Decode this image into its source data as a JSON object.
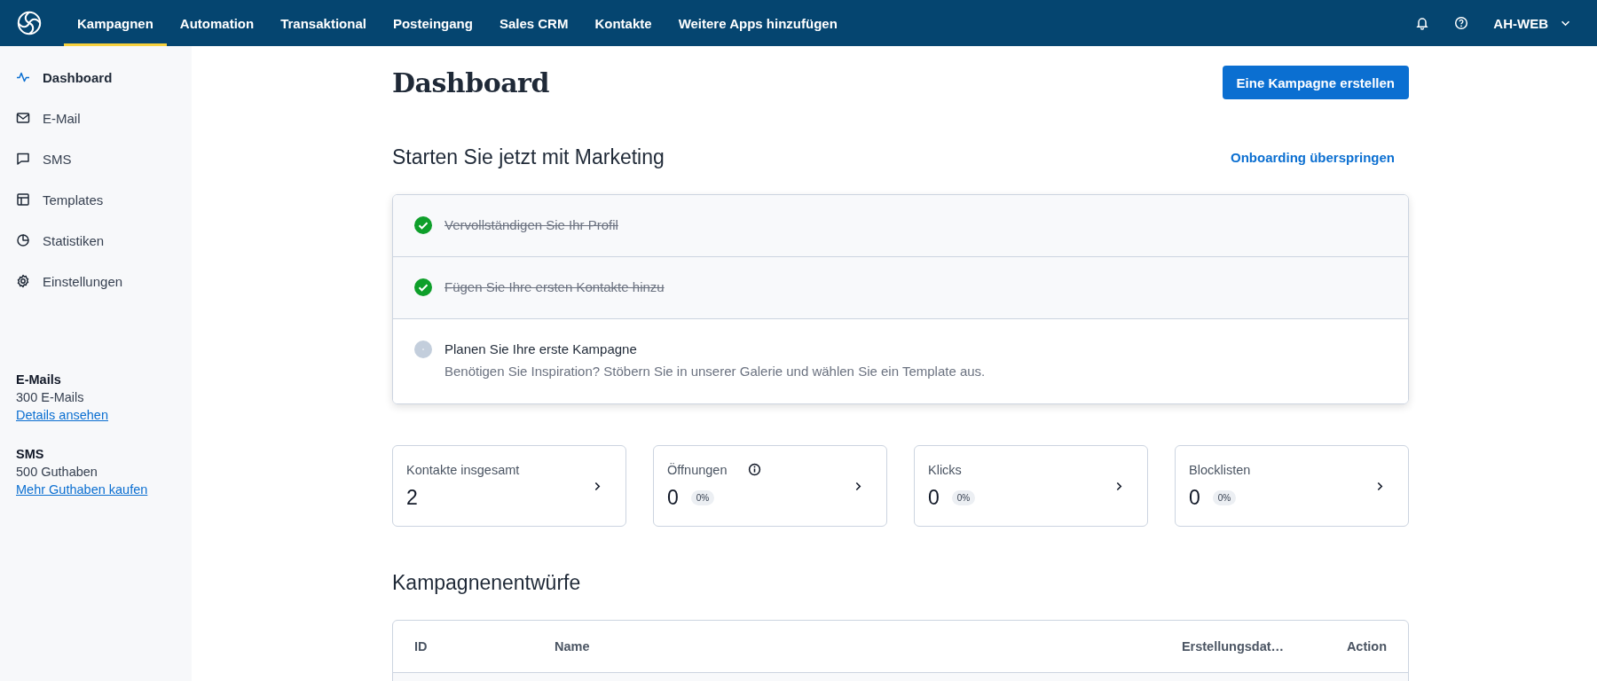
{
  "topbar": {
    "nav": [
      {
        "label": "Kampagnen",
        "selected": true
      },
      {
        "label": "Automation",
        "selected": false
      },
      {
        "label": "Transaktional",
        "selected": false
      },
      {
        "label": "Posteingang",
        "selected": false
      },
      {
        "label": "Sales CRM",
        "selected": false
      },
      {
        "label": "Kontakte",
        "selected": false
      },
      {
        "label": "Weitere Apps hinzufügen",
        "selected": false
      }
    ],
    "account": "AH-WEB"
  },
  "sidebar": {
    "items": [
      {
        "label": "Dashboard",
        "selected": true
      },
      {
        "label": "E-Mail",
        "selected": false
      },
      {
        "label": "SMS",
        "selected": false
      },
      {
        "label": "Templates",
        "selected": false
      },
      {
        "label": "Statistiken",
        "selected": false
      },
      {
        "label": "Einstellungen",
        "selected": false
      }
    ],
    "credits": [
      {
        "title": "E-Mails",
        "amount": "300 E-Mails",
        "link": "Details ansehen"
      },
      {
        "title": "SMS",
        "amount": "500 Guthaben",
        "link": "Mehr Guthaben kaufen"
      }
    ]
  },
  "page": {
    "title": "Dashboard",
    "create_button": "Eine Kampagne erstellen"
  },
  "onboarding": {
    "title": "Starten Sie jetzt mit Marketing",
    "skip_link": "Onboarding überspringen",
    "steps": [
      {
        "title": "Vervollständigen Sie Ihr Profil",
        "done": true
      },
      {
        "title": "Fügen Sie Ihre ersten Kontakte hinzu",
        "done": true
      },
      {
        "title": "Planen Sie Ihre erste Kampagne",
        "done": false,
        "description": "Benötigen Sie Inspiration? Stöbern Sie in unserer Galerie und wählen Sie ein Template aus."
      }
    ]
  },
  "stats": [
    {
      "label": "Kontakte insgesamt",
      "value": "2",
      "info": false
    },
    {
      "label": "Öffnungen",
      "value": "0",
      "percent": "0%",
      "info": true
    },
    {
      "label": "Klicks",
      "value": "0",
      "percent": "0%",
      "info": false
    },
    {
      "label": "Blocklisten",
      "value": "0",
      "percent": "0%",
      "info": false
    }
  ],
  "drafts": {
    "title": "Kampagnenentwürfe",
    "columns": [
      "ID",
      "Name",
      "Erstellungsdat…",
      "Action"
    ]
  }
}
